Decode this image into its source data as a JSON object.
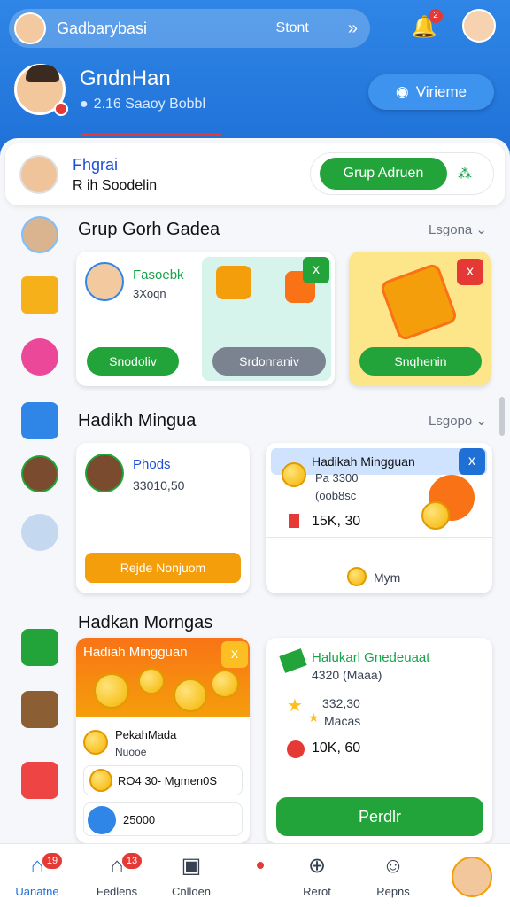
{
  "topbar": {
    "title": "Gadbarybasi",
    "start": "Stont",
    "chevron": "»",
    "bell_badge": "2"
  },
  "user": {
    "name": "GndnHan",
    "sub": "2.16  Saaoy Bobbl",
    "view_button": "Virieme"
  },
  "profile_bar": {
    "title": "Fhgrai",
    "subtitle": "R ih Soodelin",
    "grup_button": "Grup Adruen"
  },
  "section1": {
    "title": "Grup Gorh Gadea",
    "link": "Lsgona ⌄",
    "card_left": {
      "name": "Fasoebk",
      "sub": "3Xoqn",
      "btn_green": "Snodoliv",
      "btn_gray": "Srdonraniv",
      "close": "x"
    },
    "card_right": {
      "btn": "Snqhenin",
      "close": "x"
    }
  },
  "section2": {
    "title": "Hadikh Mingua",
    "link": "Lsgopo ⌄",
    "card_left": {
      "name": "Phods",
      "value": "33010,50",
      "btn": "Rejde Nonjuom"
    },
    "card_right": {
      "header": "Hadikah Mingguan",
      "close": "x",
      "line1": "Pa  3300",
      "line2": "(oob8sc",
      "amount": "15K, 30",
      "footer": "Mym"
    }
  },
  "section3": {
    "title": "Hadkan Morngas",
    "card_left": {
      "header": "Hadiah Mingguan",
      "close": "x",
      "row1_title": "PekahMada",
      "row1_sub": "Nuooe",
      "row2": "RO4 30-  Mgmen0S",
      "row3": "25000"
    },
    "card_right": {
      "title": "Halukarl Gnedeuaat",
      "line1": "4320  (Maaa)",
      "line2": "332,30",
      "line3": "Macas",
      "amount": "10K, 60",
      "btn": "Perdlr"
    }
  },
  "nav": {
    "items": [
      {
        "label": "Uanatne",
        "badge": "19"
      },
      {
        "label": "Fedlens",
        "badge": "13"
      },
      {
        "label": "Cnlloen",
        "badge": ""
      },
      {
        "label": "Rerot",
        "badge": ""
      },
      {
        "label": "Repns",
        "badge": ""
      }
    ]
  },
  "colors": {
    "brand_blue": "#1e6fd6",
    "green": "#22a43a",
    "red": "#e53935",
    "orange": "#f59e0b",
    "yellow": "#fbbf24"
  }
}
